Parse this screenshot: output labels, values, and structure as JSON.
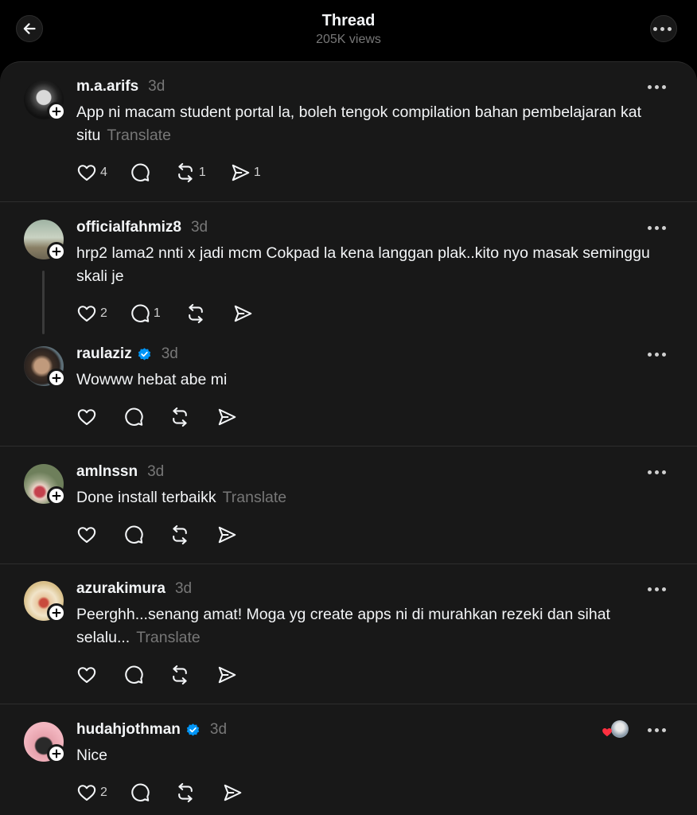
{
  "header": {
    "title": "Thread",
    "views": "205K views"
  },
  "posts": [
    {
      "username": "m.a.arifs",
      "time": "3d",
      "text": "App ni macam student portal la, boleh tengok compilation bahan pembelajaran kat situ",
      "translate": "Translate",
      "likes": "4",
      "replies": "",
      "reposts": "1",
      "shares": "1"
    },
    {
      "username": "officialfahmiz8",
      "time": "3d",
      "text": "hrp2 lama2 nnti x jadi mcm Cokpad la kena langgan plak..kito nyo masak seminggu skali je",
      "translate": "",
      "likes": "2",
      "replies": "1",
      "reposts": "",
      "shares": ""
    },
    {
      "username": "raulaziz",
      "time": "3d",
      "text": "Wowww hebat abe mi",
      "translate": "",
      "likes": "",
      "replies": "",
      "reposts": "",
      "shares": ""
    },
    {
      "username": "amlnssn",
      "time": "3d",
      "text": "Done install terbaikk",
      "translate": "Translate",
      "likes": "",
      "replies": "",
      "reposts": "",
      "shares": ""
    },
    {
      "username": "azurakimura",
      "time": "3d",
      "text": "Peerghh...senang amat! Moga yg create apps ni di murahkan rezeki dan sihat selalu...",
      "translate": "Translate",
      "likes": "",
      "replies": "",
      "reposts": "",
      "shares": ""
    },
    {
      "username": "hudahjothman",
      "time": "3d",
      "text": "Nice",
      "translate": "",
      "likes": "2",
      "replies": "",
      "reposts": "",
      "shares": ""
    }
  ],
  "colors": {
    "background": "#181818",
    "accent_verified": "#0095f6",
    "like_heart": "#ff3040",
    "muted": "#777777"
  },
  "icons": [
    "back-arrow-icon",
    "more-icon",
    "heart-icon",
    "comment-icon",
    "repost-icon",
    "share-icon",
    "verified-icon",
    "follow-plus-icon"
  ]
}
